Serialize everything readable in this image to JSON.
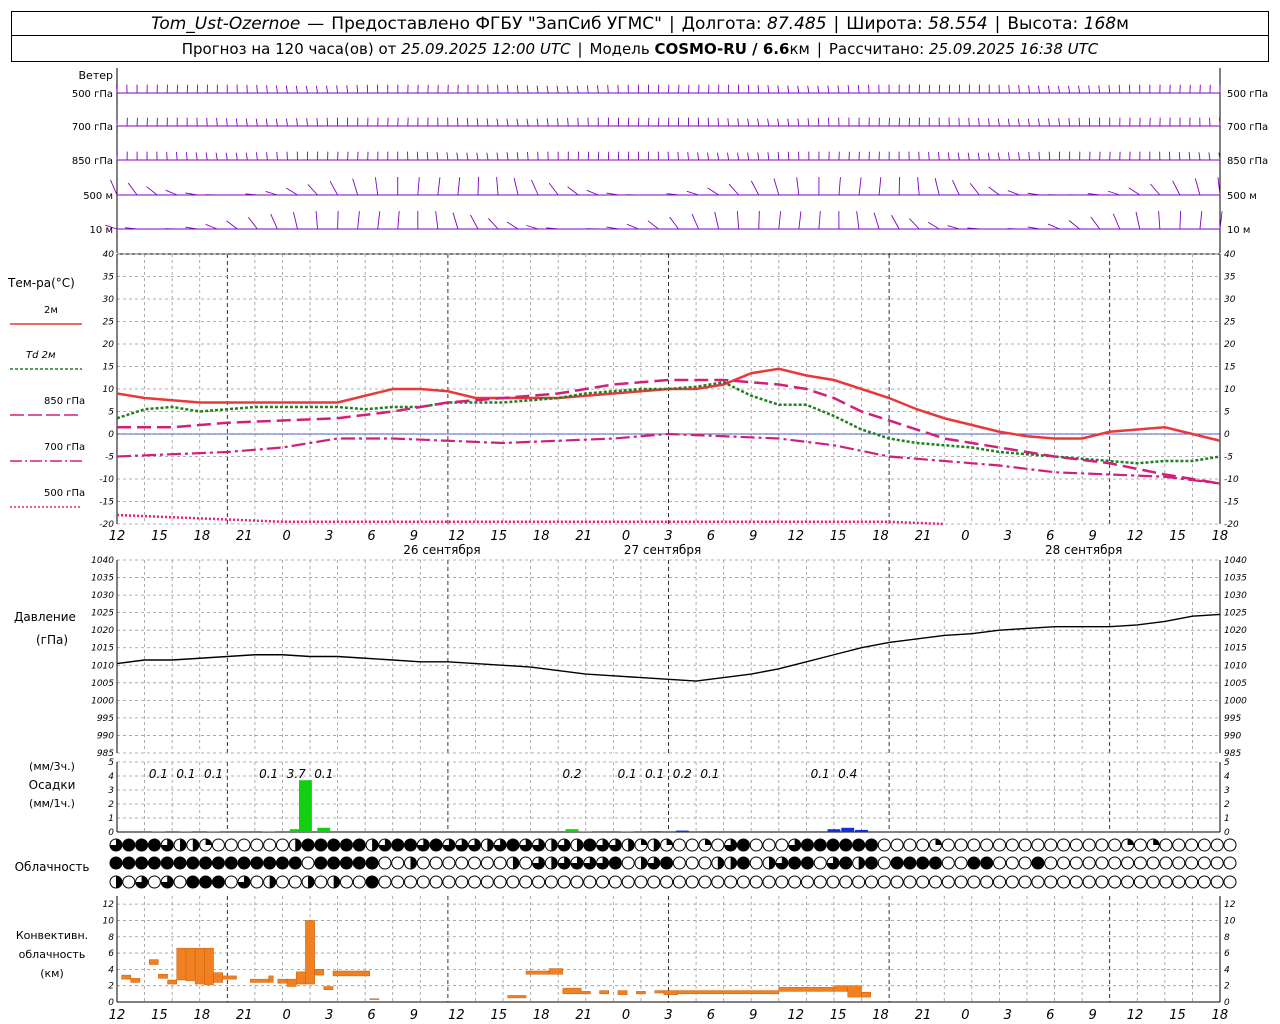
{
  "header": {
    "station": "Tom_Ust-Ozernoe",
    "dash": "—",
    "provider": "Предоставлено ФГБУ \"ЗапСиб УГМС\"",
    "lon_label": "Долгота:",
    "lon": "87.485",
    "lat_label": "Широта:",
    "lat": "58.554",
    "alt_label": "Высота:",
    "alt": "168",
    "alt_unit": "м",
    "forecast_text": "Прогноз на 120 часа(ов) от",
    "forecast_start": "25.09.2025 12:00 UTC",
    "model_label": "Модель",
    "model": "COSMO-RU / 6.6",
    "model_unit": "км",
    "calc_label": "Рассчитано:",
    "calc_time": "25.09.2025 16:38 UTC"
  },
  "hour_labels": [
    "12",
    "15",
    "18",
    "21",
    "0",
    "3",
    "6",
    "9",
    "12",
    "15",
    "18",
    "21",
    "0",
    "3",
    "6",
    "9",
    "12",
    "15",
    "18",
    "21",
    "0",
    "3",
    "6",
    "9",
    "12",
    "15",
    "18"
  ],
  "date_labels": [
    "26 сентября",
    "27 сентября",
    "28 сентября"
  ],
  "wind": {
    "title": "Ветер",
    "levels": [
      "500 гПа",
      "700 гПа",
      "850 гПа",
      "500 м",
      "10 м"
    ],
    "color": "#8000c0"
  },
  "temp": {
    "title": "Тем-ра(°C)",
    "ylim": [
      -20,
      40
    ],
    "ticks": [
      -20,
      -15,
      -10,
      -5,
      0,
      5,
      10,
      15,
      20,
      25,
      30,
      35,
      40
    ],
    "legend": [
      {
        "label": "2м",
        "color": "#e8383c"
      },
      {
        "label": "Td 2м",
        "color": "#208020"
      },
      {
        "label": "850 гПа",
        "color": "#d0207a"
      },
      {
        "label": "700 гПа",
        "color": "#d0207a"
      },
      {
        "label": "500 гПа",
        "color": "#e0207a"
      }
    ]
  },
  "pressure": {
    "title": "Давление",
    "unit": "(гПа)",
    "ylim": [
      985,
      1040
    ],
    "ticks": [
      985,
      990,
      995,
      1000,
      1005,
      1010,
      1015,
      1020,
      1025,
      1030,
      1035,
      1040
    ]
  },
  "precip": {
    "unit_3h": "(мм/3ч.)",
    "title": "Осадки",
    "unit_1h": "(мм/1ч.)",
    "ylim": [
      0,
      5
    ],
    "ticks": [
      0,
      1,
      2,
      3,
      4,
      5
    ],
    "totals": [
      {
        "h": 4.5,
        "v": "0.1"
      },
      {
        "h": 7.5,
        "v": "0.1"
      },
      {
        "h": 10.5,
        "v": "0.1"
      },
      {
        "h": 16.5,
        "v": "0.1"
      },
      {
        "h": 19.5,
        "v": "3.7"
      },
      {
        "h": 22.5,
        "v": "0.1"
      },
      {
        "h": 49.5,
        "v": "0.2"
      },
      {
        "h": 55.5,
        "v": "0.1"
      },
      {
        "h": 58.5,
        "v": "0.1"
      },
      {
        "h": 61.5,
        "v": "0.2"
      },
      {
        "h": 64.5,
        "v": "0.1"
      },
      {
        "h": 76.5,
        "v": "0.1"
      },
      {
        "h": 79.5,
        "v": "0.4"
      }
    ],
    "colors": {
      "rain": "#10d010",
      "snow": "#1030e0"
    }
  },
  "cloud": {
    "title": "Облачность",
    "rows": [
      "3444322100000024444423443433323433232433212100103400034444440000100000000000000101000000",
      "4444444444444440444440020000000203233334023400022402344034240444400440004000000000000000",
      "2030304440302002020040000000000000000000000000000000000000000000000000000000000000000000"
    ]
  },
  "conv": {
    "title_1": "Конвективн.",
    "title_2": "облачность",
    "title_3": "(км)",
    "ylim": [
      0,
      13
    ],
    "ticks": [
      0,
      2,
      4,
      6,
      8,
      10,
      12
    ],
    "color": "#f08020"
  },
  "chart_data": [
    {
      "type": "line",
      "title": "Тем-ра(°C)",
      "x_unit": "hours from 25.09.2025 12:00 UTC",
      "ylim": [
        -20,
        40
      ],
      "series": [
        {
          "name": "2м",
          "x": [
            0,
            3,
            6,
            9,
            12,
            15,
            17,
            19,
            21,
            24,
            27,
            30,
            33,
            36,
            39,
            42,
            45,
            48,
            51,
            54,
            57,
            60,
            63,
            66,
            69,
            72,
            75,
            78,
            81,
            84,
            87,
            90,
            93,
            96,
            99,
            102,
            105,
            108,
            111,
            114,
            117,
            120
          ],
          "values": [
            9,
            8,
            7.5,
            7,
            7,
            7,
            7,
            7,
            7,
            7,
            8.5,
            10,
            10,
            9.5,
            8,
            8,
            8,
            8,
            8.5,
            9,
            9.5,
            10,
            10,
            11,
            13.5,
            14.5,
            13,
            12,
            10,
            8,
            5.5,
            3.5,
            2,
            0.5,
            -0.5,
            -1,
            -1,
            0.5,
            1,
            1.5,
            0,
            -1.5
          ]
        },
        {
          "name": "Td 2м",
          "x": [
            0,
            3,
            6,
            9,
            12,
            15,
            18,
            21,
            24,
            27,
            30,
            33,
            36,
            39,
            42,
            45,
            48,
            51,
            54,
            57,
            60,
            63,
            66,
            69,
            72,
            75,
            78,
            81,
            84,
            87,
            90,
            93,
            96,
            99,
            102,
            105,
            108,
            111,
            114,
            117,
            120
          ],
          "values": [
            3.5,
            5.5,
            6,
            5,
            5.5,
            6,
            6,
            6,
            6,
            5.5,
            6,
            6,
            7,
            7,
            7,
            7.5,
            8,
            9,
            9.5,
            10,
            10,
            10.5,
            11.5,
            8.5,
            6.5,
            6.5,
            4,
            1,
            -1,
            -2,
            -2.5,
            -3,
            -4,
            -4.5,
            -5,
            -5.5,
            -6,
            -6.5,
            -6,
            -6,
            -5
          ]
        },
        {
          "name": "850 гПа",
          "x": [
            0,
            6,
            12,
            18,
            24,
            30,
            33,
            36,
            42,
            48,
            54,
            60,
            66,
            72,
            75,
            78,
            81,
            84,
            90,
            96,
            102,
            108,
            114,
            120
          ],
          "values": [
            1.5,
            1.5,
            2.5,
            3,
            3.5,
            5,
            6,
            7,
            8,
            9,
            11,
            12,
            12,
            11,
            10,
            8,
            5,
            3,
            -1,
            -3,
            -5,
            -6.5,
            -9,
            -11
          ]
        },
        {
          "name": "700 гПа",
          "x": [
            0,
            6,
            12,
            18,
            24,
            30,
            36,
            42,
            48,
            54,
            60,
            66,
            72,
            78,
            84,
            90,
            96,
            102,
            108,
            114,
            120
          ],
          "values": [
            -5,
            -4.5,
            -4,
            -3,
            -1,
            -1,
            -1.5,
            -2,
            -1.5,
            -1,
            0,
            -0.5,
            -1,
            -2.5,
            -5,
            -6,
            -7,
            -8.5,
            -9,
            -9.5,
            -11
          ]
        },
        {
          "name": "500 гПа",
          "x": [
            0,
            6,
            12,
            18,
            24,
            30,
            36,
            42,
            48,
            54,
            60,
            66,
            72,
            78,
            84,
            90
          ],
          "values": [
            -18,
            -18.5,
            -19,
            -19.5,
            -19.5,
            -19.5,
            -19.5,
            -19.5,
            -19.5,
            -19.5,
            -19.5,
            -19.5,
            -19.5,
            -19.5,
            -19.5,
            -20
          ]
        }
      ]
    },
    {
      "type": "line",
      "title": "Давление",
      "ylabel": "(гПа)",
      "ylim": [
        985,
        1040
      ],
      "series": [
        {
          "name": "Давление",
          "x": [
            0,
            3,
            6,
            9,
            12,
            15,
            18,
            21,
            24,
            27,
            30,
            33,
            36,
            39,
            42,
            45,
            48,
            51,
            54,
            57,
            60,
            63,
            66,
            69,
            72,
            75,
            78,
            81,
            84,
            87,
            90,
            93,
            96,
            99,
            102,
            105,
            108,
            111,
            114,
            117,
            120
          ],
          "values": [
            1010.5,
            1011.5,
            1011.5,
            1012,
            1012.5,
            1013,
            1013,
            1012.5,
            1012.5,
            1012,
            1011.5,
            1011,
            1011,
            1010.5,
            1010,
            1009.5,
            1008.5,
            1007.5,
            1007,
            1006.5,
            1006,
            1005.5,
            1006.5,
            1007.5,
            1009,
            1011,
            1013,
            1015,
            1016.5,
            1017.5,
            1018.5,
            1019,
            1020,
            1020.5,
            1021,
            1021,
            1021,
            1021.5,
            1022.5,
            1024,
            1024.5
          ]
        }
      ]
    },
    {
      "type": "bar",
      "title": "Осадки",
      "ylabel": "(мм/1ч.)",
      "ylim": [
        0,
        5
      ],
      "series": [
        {
          "name": "rain",
          "x": [
            4.5,
            7.5,
            10.5,
            16.5,
            19.5,
            20.5,
            22.5,
            49.5,
            51,
            55.5,
            58.5
          ],
          "values": [
            0.05,
            0.05,
            0.05,
            0.05,
            0.2,
            3.7,
            0.3,
            0.2,
            0.05,
            0.05,
            0.05
          ]
        },
        {
          "name": "snow",
          "x": [
            58.5,
            61.5,
            64.5,
            76.5,
            78,
            79.5,
            81
          ],
          "values": [
            0.05,
            0.1,
            0.05,
            0.05,
            0.2,
            0.3,
            0.15
          ]
        }
      ]
    },
    {
      "type": "bar",
      "title": "Конвективн. облачность",
      "ylabel": "(км)",
      "ylim": [
        0,
        13
      ],
      "series": [
        {
          "name": "conv",
          "segments": [
            [
              0.5,
              1.5,
              2.8,
              3.3
            ],
            [
              1.5,
              2.5,
              2.4,
              2.9
            ],
            [
              3.5,
              4.5,
              4.6,
              5.2
            ],
            [
              4.5,
              5.5,
              2.9,
              3.4
            ],
            [
              5.5,
              6.5,
              2.2,
              2.7
            ],
            [
              6.5,
              7.5,
              2.7,
              6.6
            ],
            [
              7.5,
              8.5,
              2.6,
              6.6
            ],
            [
              8.5,
              9.5,
              2.2,
              6.6
            ],
            [
              9.5,
              10.5,
              2.1,
              6.6
            ],
            [
              10.5,
              11.5,
              2.4,
              3.6
            ],
            [
              11.5,
              13,
              2.8,
              3.2
            ],
            [
              14.5,
              16.5,
              2.4,
              2.8
            ],
            [
              16.5,
              17,
              2.4,
              3.2
            ],
            [
              17.5,
              18.5,
              2.3,
              2.8
            ],
            [
              18.5,
              19.5,
              1.9,
              2.8
            ],
            [
              19.5,
              20.5,
              2.2,
              3.7
            ],
            [
              20.5,
              21.5,
              2.2,
              10
            ],
            [
              21.5,
              22.5,
              3.3,
              4.0
            ],
            [
              22.5,
              23.5,
              1.5,
              1.9
            ],
            [
              23.5,
              27.5,
              3.2,
              3.8
            ],
            [
              27.5,
              28.5,
              0.3,
              0.4
            ],
            [
              42.5,
              44.5,
              0.5,
              0.8
            ],
            [
              44.5,
              47,
              3.4,
              3.8
            ],
            [
              47,
              48.5,
              3.4,
              4.1
            ],
            [
              48.5,
              50.5,
              1.0,
              1.7
            ],
            [
              50.5,
              51.5,
              1.0,
              1.3
            ],
            [
              52.5,
              53.5,
              1.0,
              1.4
            ],
            [
              54.5,
              55.5,
              0.9,
              1.4
            ],
            [
              56.5,
              57.5,
              1.0,
              1.3
            ],
            [
              58.5,
              59.5,
              1.1,
              1.4
            ],
            [
              59.5,
              61,
              0.9,
              1.4
            ],
            [
              61,
              72,
              1.0,
              1.4
            ],
            [
              72,
              78,
              1.3,
              1.8
            ],
            [
              78,
              79.5,
              1.3,
              2.0
            ],
            [
              79.5,
              81,
              0.6,
              2.0
            ],
            [
              81,
              82,
              0.6,
              1.2
            ]
          ]
        }
      ]
    }
  ]
}
